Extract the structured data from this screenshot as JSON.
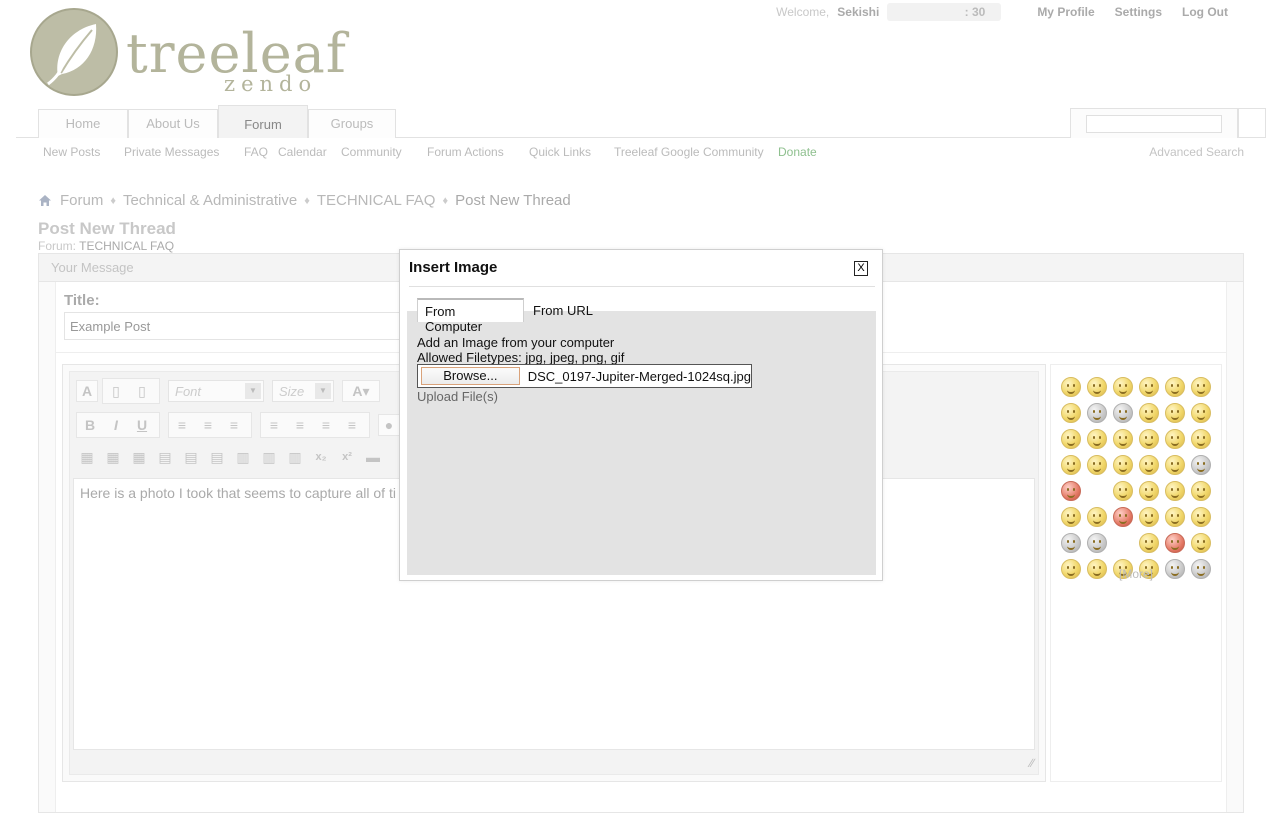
{
  "header": {
    "logo_main": "treeleaf",
    "logo_sub": "zendo",
    "welcome": "Welcome,",
    "username": "Sekishi",
    "counter": ": 30",
    "links": [
      "My Profile",
      "Settings",
      "Log Out"
    ]
  },
  "nav": {
    "tabs": [
      "Home",
      "About Us",
      "Forum",
      "Groups"
    ],
    "active_tab": "Forum"
  },
  "subnav": {
    "items": [
      "New Posts",
      "Private Messages",
      "FAQ",
      "Calendar",
      "Community",
      "Forum Actions",
      "Quick Links",
      "Treeleaf Google Community",
      "Donate"
    ],
    "advanced_search": "Advanced Search"
  },
  "breadcrumb": [
    "Forum",
    "Technical & Administrative",
    "TECHNICAL FAQ",
    "Post New Thread"
  ],
  "page": {
    "title": "Post New Thread",
    "forum_label": "Forum:",
    "forum_name": "TECHNICAL FAQ",
    "panel_title": "Your Message",
    "title_label": "Title:",
    "title_value": "Example Post"
  },
  "editor": {
    "font_placeholder": "Font",
    "size_placeholder": "Size",
    "text": "Here is a photo I took that seems to capture all of ti"
  },
  "smilies": {
    "more": "[More]"
  },
  "dialog": {
    "title": "Insert Image",
    "close": "X",
    "tabs": [
      "From Computer",
      "From URL"
    ],
    "active_tab": "From Computer",
    "intro": "Add an Image from your computer",
    "filetypes": "Allowed Filetypes: jpg, jpeg, png, gif",
    "browse_label": "Browse...",
    "file_name": "DSC_0197-Jupiter-Merged-1024sq.jpg",
    "upload_label": "Upload File(s)"
  }
}
